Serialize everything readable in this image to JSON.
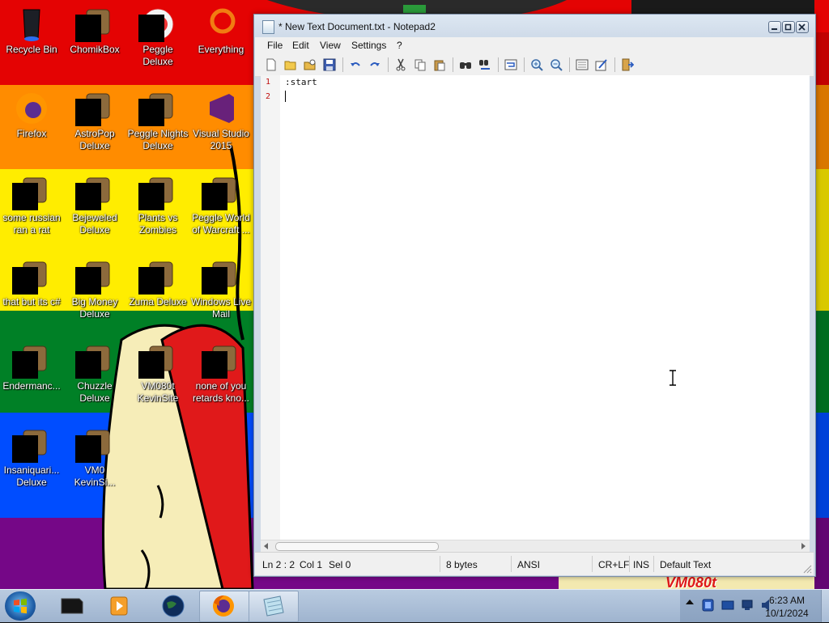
{
  "colors": {
    "stripes": [
      "#e40303",
      "#ff8c00",
      "#ffed00",
      "#008026",
      "#004dff",
      "#750787"
    ],
    "line_number": "#c01010"
  },
  "desktop": {
    "icons": [
      {
        "label": "Recycle Bin",
        "icon": "recycle-bin-icon"
      },
      {
        "label": "ChomikBox",
        "icon": "chomikbox-icon"
      },
      {
        "label": "Peggle Deluxe",
        "icon": "peggle-icon"
      },
      {
        "label": "Everything",
        "icon": "everything-search-icon"
      },
      {
        "label": "Firefox",
        "icon": "firefox-icon"
      },
      {
        "label": "AstroPop Deluxe",
        "icon": "astropop-icon"
      },
      {
        "label": "Peggle Nights Deluxe",
        "icon": "peggle-nights-icon"
      },
      {
        "label": "Visual Studio 2015",
        "icon": "visual-studio-icon"
      },
      {
        "label": "some russian ran a rat",
        "icon": "russian-app-icon"
      },
      {
        "label": "Bejeweled Deluxe",
        "icon": "bejeweled-icon"
      },
      {
        "label": "Plants vs Zombies",
        "icon": "plants-vs-zombies-icon"
      },
      {
        "label": "Peggle World of Warcraft ...",
        "icon": "peggle-wow-icon"
      },
      {
        "label": "that but its c#",
        "icon": "shortcut-icon"
      },
      {
        "label": "Big Money Deluxe",
        "icon": "big-money-icon"
      },
      {
        "label": "Zuma Deluxe",
        "icon": "zuma-icon"
      },
      {
        "label": "Windows Live Mail",
        "icon": "live-mail-icon"
      },
      {
        "label": "Endermanc...",
        "icon": "console-icon"
      },
      {
        "label": "Chuzzle Deluxe",
        "icon": "chuzzle-icon"
      },
      {
        "label": "VM080t KevinSite",
        "icon": "kevinsite-icon"
      },
      {
        "label": "none of you retards kno...",
        "icon": "firefox-like-icon"
      },
      {
        "label": "Insaniquari... Deluxe",
        "icon": "insaniquarium-icon"
      },
      {
        "label": "VM0 KevinSi...",
        "icon": "kevinsite-file-icon"
      }
    ],
    "wallpaper_text": "VM080t"
  },
  "notepad": {
    "title": "* New Text Document.txt - Notepad2",
    "menu": [
      "File",
      "Edit",
      "View",
      "Settings",
      "?"
    ],
    "toolbar": [
      "new-file-icon",
      "open-folder-icon",
      "browse-icon",
      "save-icon",
      "undo-icon",
      "redo-icon",
      "cut-icon",
      "copy-icon",
      "paste-icon",
      "find-icon",
      "replace-icon",
      "word-wrap-icon",
      "zoom-in-icon",
      "zoom-out-icon",
      "select-scheme-icon",
      "customize-scheme-icon",
      "exit-icon"
    ],
    "lines": [
      {
        "num": "1",
        "text": ":start"
      },
      {
        "num": "2",
        "text": ""
      }
    ],
    "status": {
      "position": "Ln 2 : 2",
      "column": "Col 1",
      "selection": "Sel 0",
      "size": "8 bytes",
      "encoding": "ANSI",
      "line_endings": "CR+LF",
      "mode": "INS",
      "scheme": "Default Text"
    }
  },
  "taskbar": {
    "time": "6:23 AM",
    "date": "10/1/2024",
    "buttons": [
      "cmd-window-icon",
      "media-player-icon",
      "earth-app-icon",
      "firefox-taskbar-icon",
      "notepad-taskbar-icon"
    ]
  }
}
